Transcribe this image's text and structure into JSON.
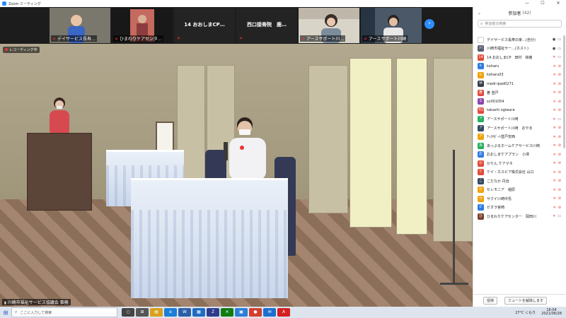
{
  "window": {
    "title": "Zoom ミーティング",
    "controls": [
      "—",
      "☐",
      "✕"
    ]
  },
  "thumbnails": [
    {
      "name": "デイサービス長寿…",
      "muted": true
    },
    {
      "name": "ひまわりケアセンタ…",
      "muted": true
    },
    {
      "name": "14 おおしまCP…",
      "muted": true,
      "video": false
    },
    {
      "name": "西口接骨院　鹿…",
      "muted": true,
      "video": false
    },
    {
      "name": "アースサポート川…",
      "muted": true
    },
    {
      "name": "アースサポート川崎",
      "muted": true
    }
  ],
  "main_video": {
    "recording_label": "レコーディング中",
    "speaker_name": "川崎市福祉サービス協議会 事務"
  },
  "participants": {
    "title": "参加者",
    "count": "(42)",
    "search_placeholder": "参加者の検索",
    "items": [
      {
        "initial": "",
        "name": "デイサービス長寿の家…(自分)",
        "color": "#ffffff",
        "mic_muted": false,
        "video_off": false
      },
      {
        "initial": "川",
        "name": "川崎市福祉サー…(ホスト)",
        "color": "#555b6e",
        "mic_muted": false,
        "video_off": false
      },
      {
        "initial": "14",
        "name": "14 おおしまCP　田村　和義",
        "color": "#e04a3b",
        "mic_muted": true,
        "video_off": false
      },
      {
        "initial": "k",
        "name": "koharu",
        "color": "#2d7be0",
        "mic_muted": true,
        "video_off": true
      },
      {
        "initial": "k",
        "name": "koharu03",
        "color": "#f0a30a",
        "mic_muted": true,
        "video_off": true
      },
      {
        "initial": "M",
        "name": "medi-ipad0271",
        "color": "#3a3f4b",
        "mic_muted": true,
        "video_off": true
      },
      {
        "initial": "蒼戸",
        "name": "蒼 登戸",
        "color": "#e04a3b",
        "mic_muted": true,
        "video_off": true
      },
      {
        "initial": "S",
        "name": "sc001054",
        "color": "#8e44ad",
        "mic_muted": true,
        "video_off": true
      },
      {
        "initial": "TO",
        "name": "takashi ogiwara",
        "color": "#e04a3b",
        "mic_muted": true,
        "video_off": true
      },
      {
        "initial": "ア",
        "name": "アースサポート川崎",
        "color": "#27ae60",
        "mic_muted": true,
        "video_off": false
      },
      {
        "initial": "ア",
        "name": "アースサポート川崎　おやま",
        "color": "#34495e",
        "mic_muted": true,
        "video_off": true
      },
      {
        "initial": "ア",
        "name": "ｱｰｽｻﾎﾟｰﾄ登戸安西",
        "color": "#f0a30a",
        "mic_muted": true,
        "video_off": true
      },
      {
        "initial": "あ",
        "name": "あっぷるホームケアサービス川崎",
        "color": "#27ae60",
        "mic_muted": true,
        "video_off": true
      },
      {
        "initial": "お",
        "name": "おおしまケアプラン　小澤",
        "color": "#2d7be0",
        "mic_muted": true,
        "video_off": true
      },
      {
        "initial": "か",
        "name": "かりん ケアマネ",
        "color": "#e04a3b",
        "mic_muted": true,
        "video_off": true
      },
      {
        "initial": "ケ",
        "name": "ケイ・ホスピア株式会社 山口",
        "color": "#e04a3b",
        "mic_muted": true,
        "video_off": true
      },
      {
        "initial": "こ",
        "name": "こだなか 丹治",
        "color": "#34495e",
        "mic_muted": true,
        "video_off": true
      },
      {
        "initial": "セ",
        "name": "セレモニア　稲原",
        "color": "#f0a30a",
        "mic_muted": true,
        "video_off": true
      },
      {
        "initial": "サ",
        "name": "サクイ川崎中島",
        "color": "#f0a30a",
        "mic_muted": true,
        "video_off": true
      },
      {
        "initial": "ビ",
        "name": "ビオラ宮崎",
        "color": "#2d7be0",
        "mic_muted": true,
        "video_off": true
      },
      {
        "initial": "ひ",
        "name": "ひまわりケアセンター　岡田川",
        "color": "#7b3f2b",
        "mic_muted": true,
        "video_off": false
      }
    ],
    "footer": {
      "invite": "招待",
      "unmute": "ミュートを解除します"
    }
  },
  "taskbar": {
    "search_placeholder": "ここに入力して検索",
    "weather": "27°C くもり",
    "time": "16:04",
    "date": "2021/06/28",
    "app_icons": [
      {
        "name": "task-view",
        "label": "○",
        "color": "#444"
      },
      {
        "name": "cortana",
        "label": "⊞",
        "color": "#555"
      },
      {
        "name": "file-explorer",
        "label": "▤",
        "color": "#d8a11b"
      },
      {
        "name": "edge",
        "label": "e",
        "color": "#1a7fd6"
      },
      {
        "name": "word",
        "label": "W",
        "color": "#2b5ea8"
      },
      {
        "name": "store",
        "label": "▦",
        "color": "#1f6dc1"
      },
      {
        "name": "zoom",
        "label": "Z",
        "color": "#2d3c8c"
      },
      {
        "name": "xbox",
        "label": "✕",
        "color": "#107c10"
      },
      {
        "name": "photos",
        "label": "▣",
        "color": "#2c7fd4"
      },
      {
        "name": "chrome",
        "label": "●",
        "color": "#d33e2e"
      },
      {
        "name": "mail",
        "label": "✉",
        "color": "#1c6fce"
      },
      {
        "name": "acrobat",
        "label": "A",
        "color": "#d21f1f"
      }
    ]
  }
}
